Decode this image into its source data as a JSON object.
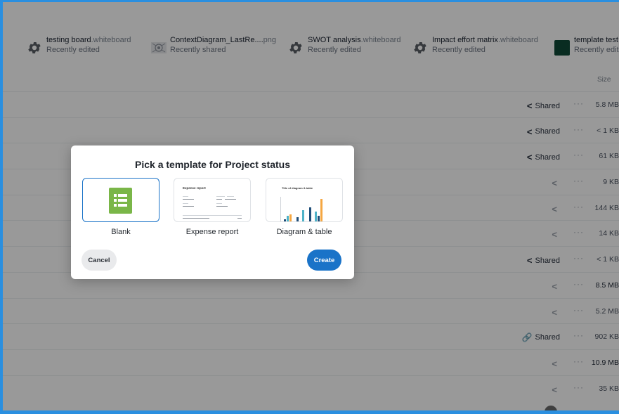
{
  "recent": [
    {
      "name": "testing board",
      "ext": ".whiteboard",
      "sub": "Recently edited",
      "icon": "gear-icon"
    },
    {
      "name": "ContextDiagram_LastRe....",
      "ext": "png",
      "sub": "Recently shared",
      "icon": "image-thumbnail-icon"
    },
    {
      "name": "SWOT analysis",
      "ext": ".whiteboard",
      "sub": "Recently edited",
      "icon": "gear-icon"
    },
    {
      "name": "Impact effort matrix",
      "ext": ".whiteboard",
      "sub": "Recently edited",
      "icon": "gear-icon"
    },
    {
      "name": "template test",
      "ext": ".",
      "sub": "Recently edited",
      "icon": "document-thumbnail-icon"
    }
  ],
  "list": {
    "size_header": "Size",
    "rows": [
      {
        "share": "Shared",
        "shared": true,
        "size": "5.8 MB"
      },
      {
        "share": "Shared",
        "shared": true,
        "size": "< 1 KB"
      },
      {
        "share": "Shared",
        "shared": true,
        "size": "61 KB"
      },
      {
        "share": "",
        "shared": false,
        "size": "9 KB"
      },
      {
        "share": "",
        "shared": false,
        "size": "144 KB"
      },
      {
        "share": "",
        "shared": false,
        "size": "14 KB"
      },
      {
        "share": "Shared",
        "shared": true,
        "size": "< 1 KB"
      },
      {
        "share": "",
        "shared": false,
        "size": "8.5 MB"
      },
      {
        "share": "",
        "shared": false,
        "size": "5.2 MB"
      },
      {
        "share": "Shared",
        "shared": true,
        "link": true,
        "size": "902 KB"
      },
      {
        "share": "",
        "shared": false,
        "size": "10.9 MB"
      },
      {
        "share": "",
        "shared": false,
        "size": "35 KB"
      }
    ],
    "more_label": "···"
  },
  "dialog": {
    "title": "Pick a template for Project status",
    "templates": [
      {
        "label": "Blank"
      },
      {
        "label": "Expense report",
        "preview_title": "Expense report"
      },
      {
        "label": "Diagram & table",
        "preview_title": "Title of diagram & table"
      }
    ],
    "cancel_label": "Cancel",
    "create_label": "Create"
  },
  "colors": {
    "accent": "#1a73c8",
    "sheet_green": "#7ab648",
    "bar_blue": "#1f4e79",
    "bar_teal": "#4fb3c8",
    "bar_orange": "#f5a742"
  }
}
